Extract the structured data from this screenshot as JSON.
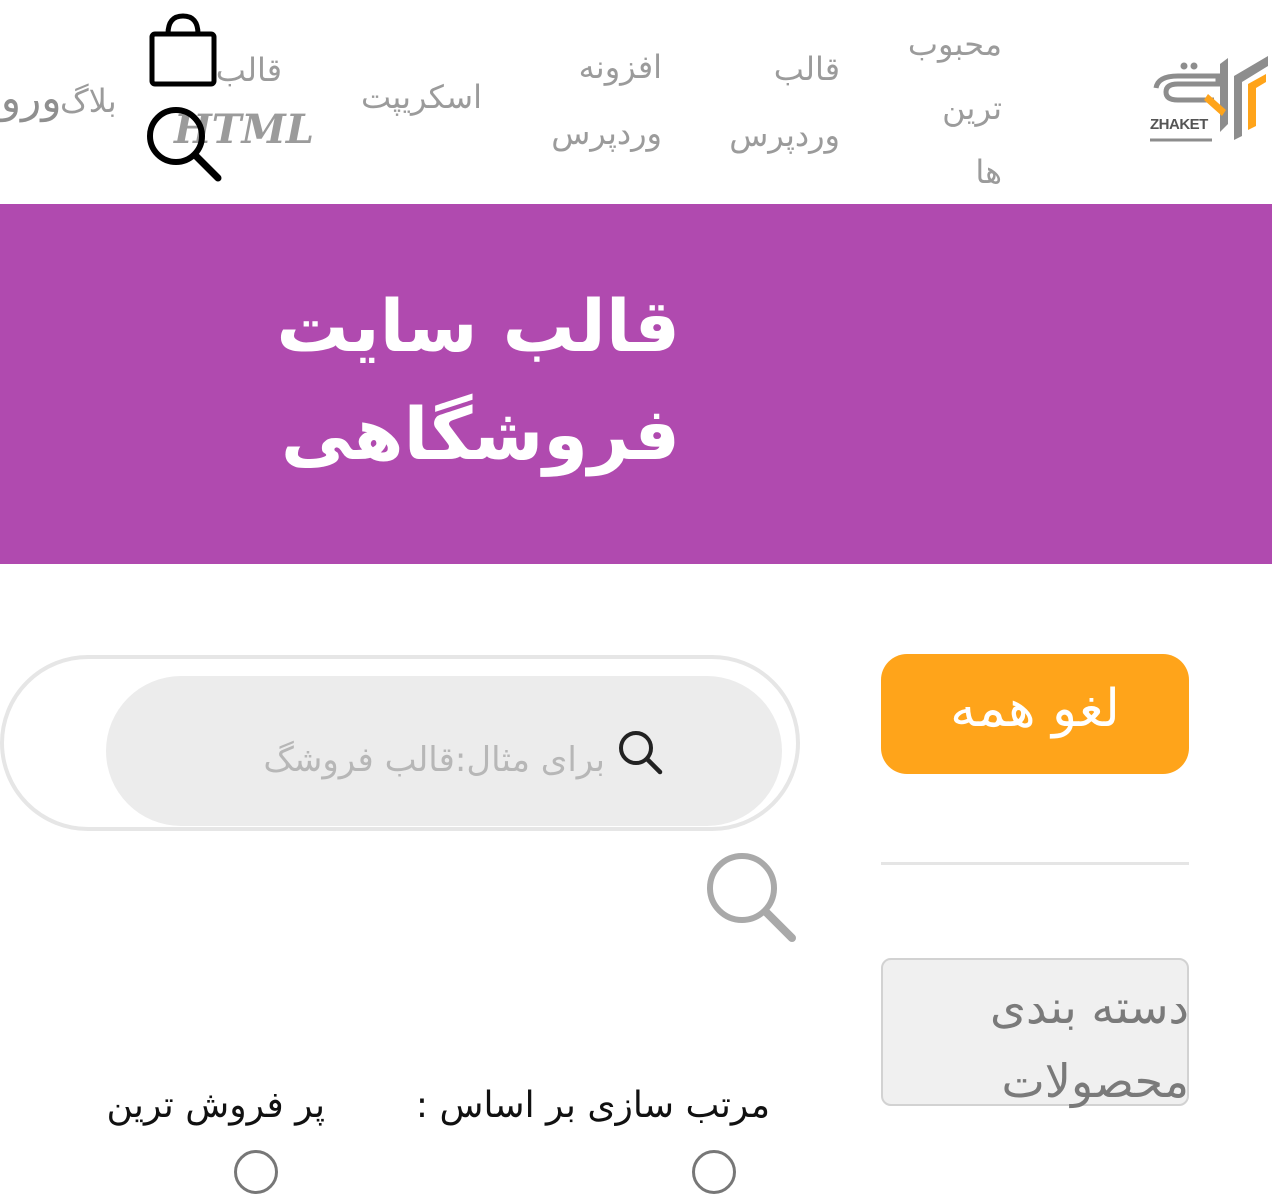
{
  "header": {
    "logo_text": "ZHAKET",
    "nav": {
      "popular": [
        "محبوب",
        "ترین",
        "ها"
      ],
      "wp_theme": [
        "قالب",
        "وردپرس"
      ],
      "wp_plugin": [
        "افزونه",
        "وردپرس"
      ],
      "script": "اسکریپت",
      "html_theme": [
        "قالب",
        "HTML"
      ],
      "blog": "بلاگ",
      "login": "ورود"
    },
    "icons": {
      "cart": "shopping-bag-icon",
      "search": "search-icon"
    }
  },
  "hero": {
    "title_line1": "قالب سایت",
    "title_line2": "فروشگاهی",
    "background": "#b04aaf"
  },
  "filters": {
    "search_placeholder": "برای مثال:قالب فروشگ",
    "reset_label": "لغو همه",
    "category_label": "دسته بندی محصولات",
    "accent": "#ffa41a"
  },
  "sort": {
    "label": "مرتب سازی بر اساس :",
    "value": "پر فروش ترین"
  }
}
